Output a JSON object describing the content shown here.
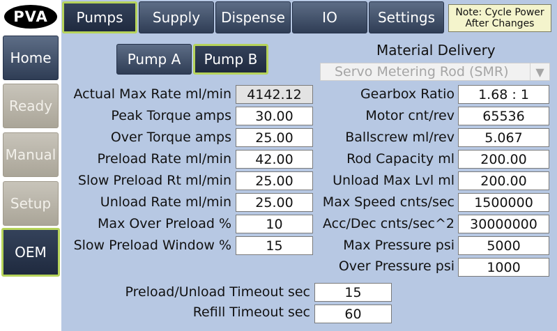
{
  "logo": "PVA",
  "nav": [
    "Home",
    "Ready",
    "Manual",
    "Setup",
    "OEM"
  ],
  "tabs": [
    "Pumps",
    "Supply",
    "Dispense",
    "IO",
    "Settings"
  ],
  "note": "Note: Cycle Power After Changes",
  "pumps": [
    "Pump A",
    "Pump B"
  ],
  "material_delivery": {
    "label": "Material Delivery",
    "value": "Servo Metering Rod (SMR)"
  },
  "left_fields": [
    {
      "label": "Actual Max Rate ml/min",
      "value": "4142.12"
    },
    {
      "label": "Peak Torque amps",
      "value": "30.00"
    },
    {
      "label": "Over Torque amps",
      "value": "25.00"
    },
    {
      "label": "Preload Rate ml/min",
      "value": "42.00"
    },
    {
      "label": "Slow Preload Rt ml/min",
      "value": "25.00"
    },
    {
      "label": "Unload Rate ml/min",
      "value": "25.00"
    },
    {
      "label": "Max Over Preload %",
      "value": "10"
    },
    {
      "label": "Slow Preload Window %",
      "value": "15"
    }
  ],
  "right_fields": [
    {
      "label": "Gearbox Ratio",
      "value": "1.68 : 1"
    },
    {
      "label": "Motor cnt/rev",
      "value": "65536"
    },
    {
      "label": "Ballscrew ml/rev",
      "value": "5.067"
    },
    {
      "label": "Rod Capacity ml",
      "value": "200.00"
    },
    {
      "label": "Unload Max Lvl ml",
      "value": "200.00"
    },
    {
      "label": "Max Speed cnts/sec",
      "value": "1500000"
    },
    {
      "label": "Acc/Dec cnts/sec^2",
      "value": "30000000"
    },
    {
      "label": "Max Pressure psi",
      "value": "5000"
    },
    {
      "label": "Over Pressure psi",
      "value": "1000"
    }
  ],
  "bottom_fields": [
    {
      "label": "Preload/Unload Timeout sec",
      "value": "15"
    },
    {
      "label": "Refill Timeout sec",
      "value": "60"
    }
  ]
}
